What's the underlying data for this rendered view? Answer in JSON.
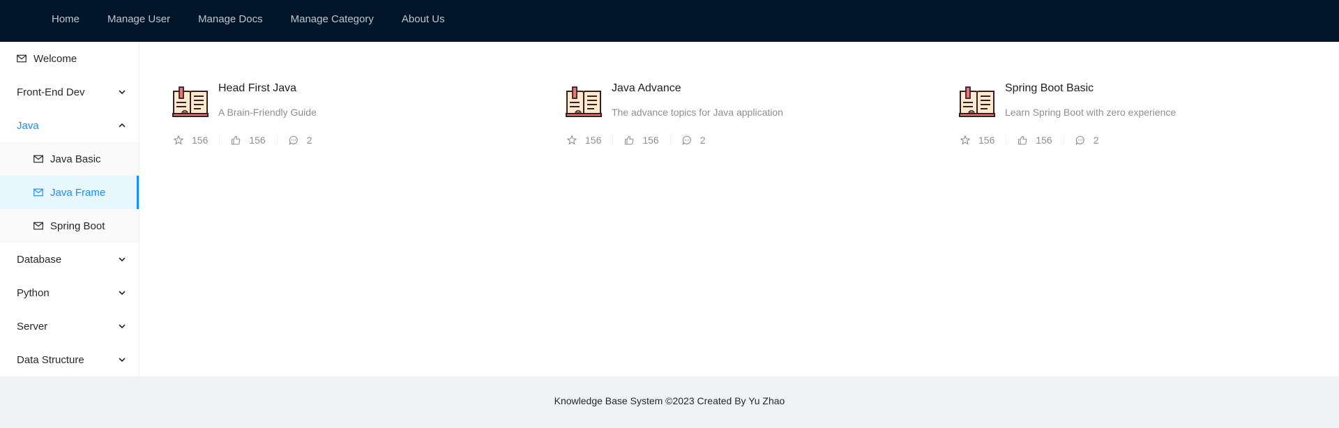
{
  "header": {
    "nav": [
      "Home",
      "Manage User",
      "Manage Docs",
      "Manage Category",
      "About Us"
    ]
  },
  "sidebar": {
    "welcome": "Welcome",
    "front_end": "Front-End Dev",
    "java": "Java",
    "java_sub": [
      "Java Basic",
      "Java Frame",
      "Spring Boot"
    ],
    "selected": "Java Frame",
    "database": "Database",
    "python": "Python",
    "server": "Server",
    "data_structure": "Data Structure"
  },
  "cards": [
    {
      "title": "Head First Java",
      "description": "A Brain-Friendly Guide",
      "stars": "156",
      "likes": "156",
      "comments": "2"
    },
    {
      "title": "Java Advance",
      "description": "The advance topics for Java application",
      "stars": "156",
      "likes": "156",
      "comments": "2"
    },
    {
      "title": "Spring Boot Basic",
      "description": "Learn Spring Boot with zero experience",
      "stars": "156",
      "likes": "156",
      "comments": "2"
    }
  ],
  "footer": {
    "text": "Knowledge Base System ©2023 Created By Yu Zhao"
  },
  "colors": {
    "header_bg": "#001529",
    "accent": "#1890ff",
    "selected_bg": "#e6f7ff",
    "footer_bg": "#f0f2f5"
  },
  "icons": {
    "menu": "mail-icon",
    "card": "book-icon",
    "star": "star-icon",
    "like": "like-icon",
    "comment": "message-icon"
  }
}
